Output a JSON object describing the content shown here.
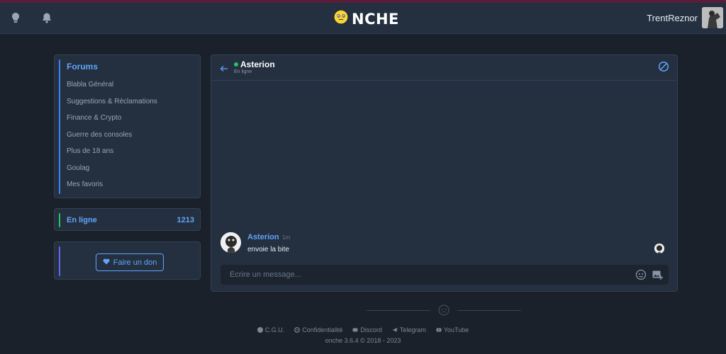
{
  "header": {
    "logo_text": "NCHE",
    "username": "TrentReznor",
    "icons": [
      "lightbulb-icon",
      "bell-icon",
      "smiley-logo-icon"
    ]
  },
  "sidebar": {
    "forums_title": "Forums",
    "forums": [
      {
        "label": "Blabla Général"
      },
      {
        "label": "Suggestions & Réclamations"
      },
      {
        "label": "Finance & Crypto"
      },
      {
        "label": "Guerre des consoles"
      },
      {
        "label": "Plus de 18 ans"
      },
      {
        "label": "Goulag"
      },
      {
        "label": "Mes favoris"
      }
    ],
    "online_label": "En ligne",
    "online_count": "1213",
    "donate_label": "Faire un don"
  },
  "chat": {
    "peer_name": "Asterion",
    "peer_status": "En ligne",
    "messages": [
      {
        "author": "Asterion",
        "time": "1m",
        "text": "envoie la bite"
      }
    ],
    "composer_placeholder": "Écrire un message..."
  },
  "footer": {
    "links": [
      {
        "label": "C.G.U."
      },
      {
        "label": "Confidentialité"
      },
      {
        "label": "Discord"
      },
      {
        "label": "Telegram"
      },
      {
        "label": "YouTube"
      }
    ],
    "copyright": "onche 3.6.4 © 2018 - 2023"
  },
  "colors": {
    "background": "#1b212b",
    "panel": "#243040",
    "accent": "#60a5fa",
    "online": "#22c55e"
  }
}
